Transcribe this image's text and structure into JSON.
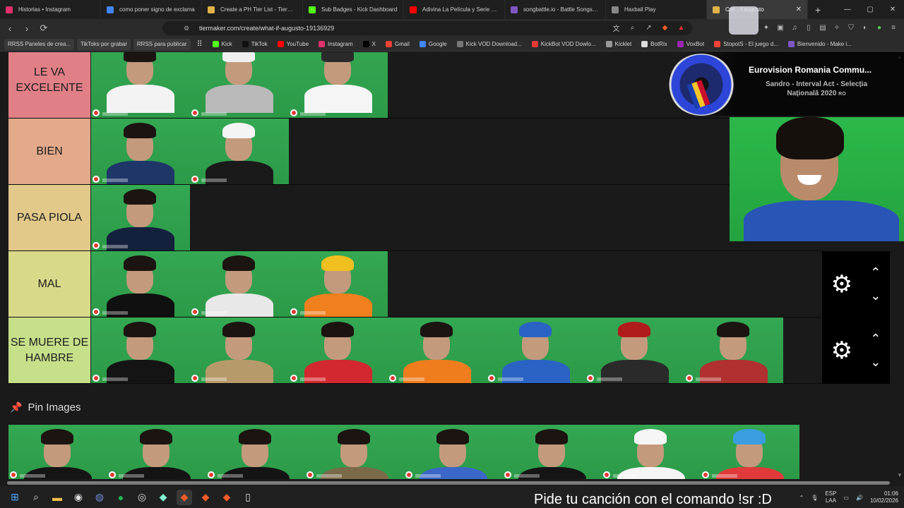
{
  "browser": {
    "tabs": [
      {
        "title": "Historias • Instagram",
        "color": "#e1306c",
        "active": false
      },
      {
        "title": "como poner signo de exclama",
        "color": "#4285f4",
        "active": false
      },
      {
        "title": "Create a PH Tier List - TierMak",
        "color": "#e0b44a",
        "active": false
      },
      {
        "title": "Sub Badges - Kick Dashboard",
        "color": "#53fc18",
        "active": false
      },
      {
        "title": "Adivina La Película y Serie por",
        "color": "#ff0000",
        "active": false
      },
      {
        "title": "songbattle.io - Battle Songs ag",
        "color": "#7e57c2",
        "active": false
      },
      {
        "title": "Haxball Play",
        "color": "#888888",
        "active": false
      },
      {
        "title": "Cre... f augusto",
        "color": "#e0b44a",
        "active": true
      }
    ],
    "new_tab": "+",
    "window_controls": [
      "—",
      "▢",
      "✕"
    ],
    "url": "tiermaker.com/create/what-if-augusto-19136929",
    "bookmarks": [
      {
        "label": "RRSS Paneles de crea...",
        "chip": true
      },
      {
        "label": "TikToks por grabar",
        "chip": true
      },
      {
        "label": "RRSS para publicar",
        "chip": true
      },
      {
        "label": "",
        "chip": false,
        "icon": "apps-grid-icon"
      },
      {
        "label": "Kick",
        "color": "#53fc18"
      },
      {
        "label": "TikTok",
        "color": "#111111"
      },
      {
        "label": "YouTube",
        "color": "#ff0000"
      },
      {
        "label": "Instagram",
        "color": "#e1306c"
      },
      {
        "label": "X",
        "color": "#000000"
      },
      {
        "label": "Gmail",
        "color": "#ea4335"
      },
      {
        "label": "Google",
        "color": "#4285f4"
      },
      {
        "label": "Kick VOD Download...",
        "color": "#777777"
      },
      {
        "label": "KickBot VOD Dowlo...",
        "color": "#e53935"
      },
      {
        "label": "Kicklet",
        "color": "#999999"
      },
      {
        "label": "BotRix",
        "color": "#dddddd"
      },
      {
        "label": "VoxBot",
        "color": "#9c27b0"
      },
      {
        "label": "StopotS - El juego d...",
        "color": "#f44336"
      },
      {
        "label": "Bienvenido - Make i...",
        "color": "#7e57c2"
      }
    ]
  },
  "tiers": [
    {
      "label": "LE VA EXCELENTE",
      "color": "#e07f86",
      "items": [
        {
          "body": "#f3f3f3",
          "hair": "#1b1410"
        },
        {
          "body": "#b9b9b9",
          "hair": "#f0f0f0"
        },
        {
          "body": "#f5f5f5",
          "hair": "#2a2a2a"
        }
      ],
      "controls": false
    },
    {
      "label": "BIEN",
      "color": "#e2a98a",
      "items": [
        {
          "body": "#1e3768",
          "hair": "#1b1410"
        },
        {
          "body": "#1a1a1a",
          "hair": "#f4f4f4"
        }
      ],
      "controls": false
    },
    {
      "label": "PASA PIOLA",
      "color": "#e2c98a",
      "items": [
        {
          "body": "#14213d",
          "hair": "#1b1410"
        }
      ],
      "controls": false
    },
    {
      "label": "MAL",
      "color": "#d9d98a",
      "items": [
        {
          "body": "#101010",
          "hair": "#1b1410"
        },
        {
          "body": "#e8e8e8",
          "hair": "#1b1410"
        },
        {
          "body": "#f07f1e",
          "hair": "#f0c020"
        }
      ],
      "controls": true
    },
    {
      "label": "SE MUERE DE HAMBRE",
      "color": "#c6e08a",
      "items": [
        {
          "body": "#141414",
          "hair": "#1b1410"
        },
        {
          "body": "#b79a6a",
          "hair": "#1b1410"
        },
        {
          "body": "#d3282f",
          "hair": "#1b1410"
        },
        {
          "body": "#ef7d1e",
          "hair": "#1b1410"
        },
        {
          "body": "#2a63c4",
          "hair": "#2a63c4"
        },
        {
          "body": "#2a2a2a",
          "hair": "#b01c1c"
        },
        {
          "body": "#b0312f",
          "hair": "#1b1410"
        }
      ],
      "controls": true
    }
  ],
  "controls": {
    "gear": "gear-icon",
    "up": "chevron-up-icon",
    "down": "chevron-down-icon"
  },
  "pin": {
    "title": "Pin Images",
    "items": [
      {
        "body": "#151515",
        "hair": "#1b1410"
      },
      {
        "body": "#141414",
        "hair": "#1b1410"
      },
      {
        "body": "#141414",
        "hair": "#1b1410"
      },
      {
        "body": "#7a6a4a",
        "hair": "#1b1410"
      },
      {
        "body": "#3a67c8",
        "hair": "#1b1410"
      },
      {
        "body": "#151515",
        "hair": "#1b1410"
      },
      {
        "body": "#f5f5f5",
        "hair": "#f5f5f5"
      },
      {
        "body": "#e03a3a",
        "hair": "#3a9de0"
      }
    ]
  },
  "now_playing": {
    "title": "Eurovision Romania Commu...",
    "subtitle": "Sandro - Interval Act - Selecția Națională 2020 ",
    "country": "RO"
  },
  "ticker": "Pide tu canción con el comando !sr :D",
  "tray": {
    "lang_top": "ESP",
    "lang_bottom": "LAA",
    "time": "01:06",
    "date": "10/02/2026"
  }
}
